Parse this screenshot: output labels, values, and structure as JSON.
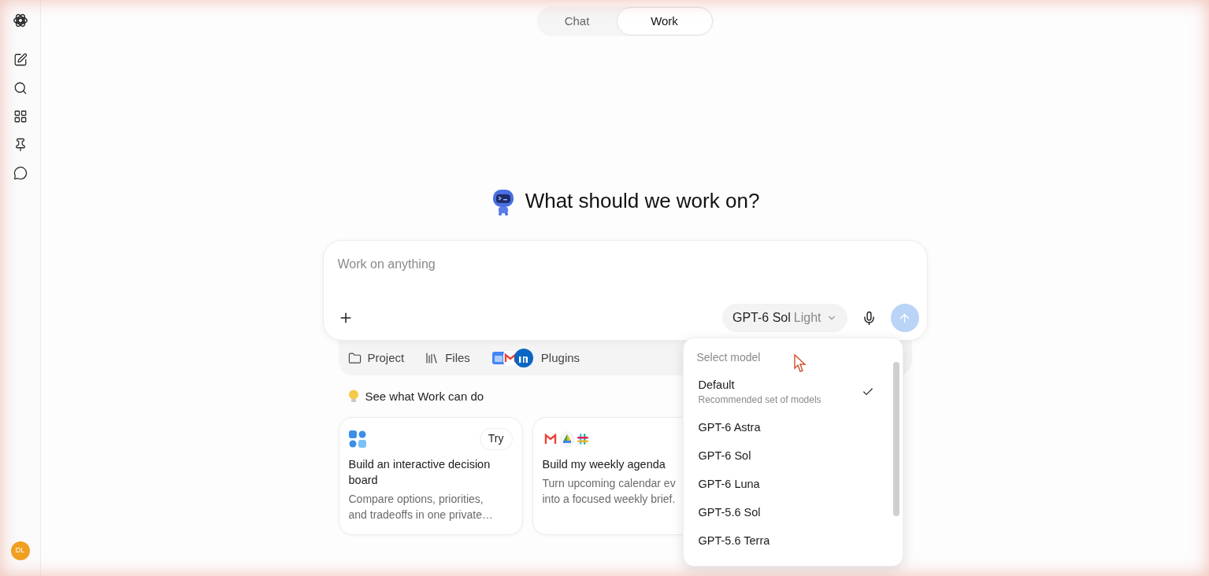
{
  "mode_tabs": [
    {
      "label": "Chat",
      "selected": false
    },
    {
      "label": "Work",
      "selected": true
    }
  ],
  "sidebar": {
    "avatar": "DL"
  },
  "heading": "What should we work on?",
  "composer": {
    "placeholder": "Work on anything",
    "model_button": {
      "name": "GPT-6 Sol",
      "variant": "Light"
    }
  },
  "tray": [
    {
      "kind": "project",
      "label": "Project"
    },
    {
      "kind": "files",
      "label": "Files"
    },
    {
      "kind": "plugins",
      "label": "Plugins"
    }
  ],
  "suggestions_title": "See what Work can do",
  "cards": [
    {
      "kind": "board",
      "title": "Build an interactive decision board",
      "lines": [
        "Compare options, priorities,",
        "and tradeoffs in one private…"
      ],
      "try": "Try"
    },
    {
      "kind": "agenda",
      "title": "Build my weekly agenda",
      "lines": [
        "Turn upcoming calendar ev",
        "into a focused weekly brief."
      ]
    }
  ],
  "model_menu": {
    "title": "Select model",
    "items": [
      {
        "label": "Default",
        "description": "Recommended set of models",
        "selected": true
      },
      {
        "label": "GPT-6 Astra",
        "selected": false
      },
      {
        "label": "GPT-6 Sol",
        "selected": false
      },
      {
        "label": "GPT-6 Luna",
        "selected": false
      },
      {
        "label": "GPT-5.6 Sol",
        "selected": false
      },
      {
        "label": "GPT-5.6 Terra",
        "selected": false
      }
    ]
  }
}
